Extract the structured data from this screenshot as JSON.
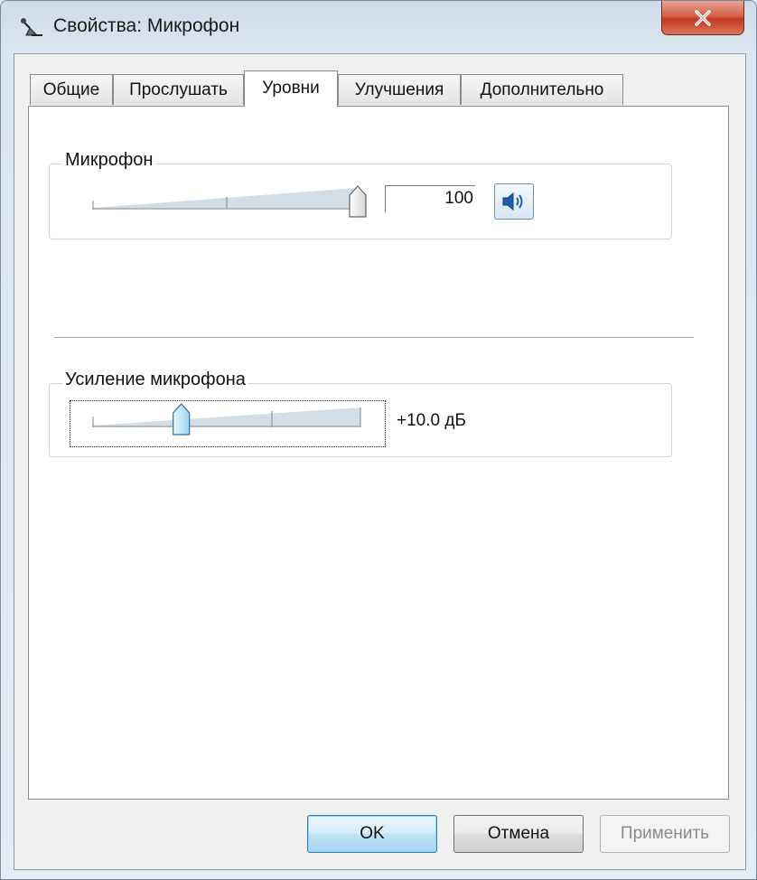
{
  "window": {
    "title": "Свойства: Микрофон",
    "title_icon": "microphone-icon",
    "close_icon": "close-icon"
  },
  "tabs": [
    {
      "label": "Общие",
      "active": false
    },
    {
      "label": "Прослушать",
      "active": false
    },
    {
      "label": "Уровни",
      "active": true
    },
    {
      "label": "Улучшения",
      "active": false
    },
    {
      "label": "Дополнительно",
      "active": false
    }
  ],
  "levels": {
    "microphone": {
      "label": "Микрофон",
      "value": "100",
      "level": 100,
      "mute_icon": "speaker-icon"
    },
    "boost": {
      "label": "Усиление микрофона",
      "value": "+10.0 дБ",
      "level": 0.33
    }
  },
  "buttons": {
    "ok": "OK",
    "cancel": "Отмена",
    "apply": "Применить"
  },
  "colors": {
    "accent": "#3c7fb1",
    "close": "#c4391f"
  }
}
